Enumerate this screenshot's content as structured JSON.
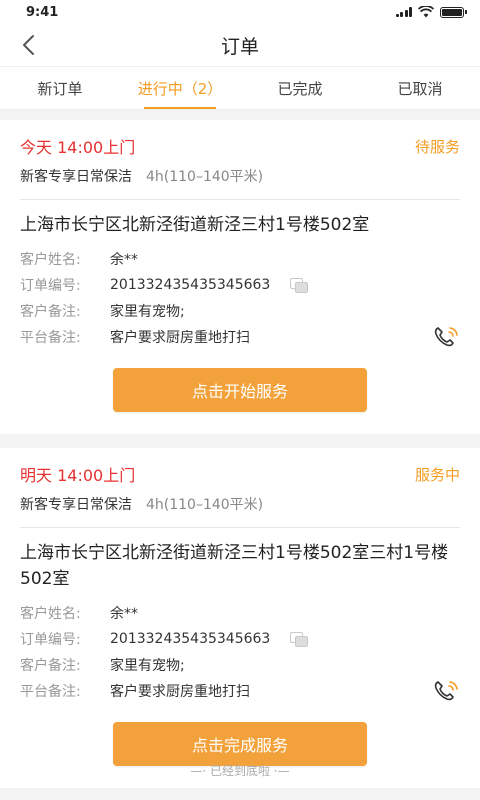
{
  "status_bar": {
    "time": "9:41"
  },
  "nav": {
    "title": "订单"
  },
  "tabs": [
    {
      "label": "新订单"
    },
    {
      "label": "进行中（2）"
    },
    {
      "label": "已完成"
    },
    {
      "label": "已取消"
    }
  ],
  "orders": [
    {
      "time": "今天 14:00上门",
      "status": "待服务",
      "service": "新客专享日常保洁",
      "duration": "4h(110–140平米)",
      "address": "上海市长宁区北新泾街道新泾三村1号楼502室",
      "customer_label": "客户姓名:",
      "customer": "余**",
      "order_no_label": "订单编号:",
      "order_no": "201332435435345663",
      "customer_note_label": "客户备注:",
      "customer_note": "家里有宠物;",
      "platform_note_label": "平台备注:",
      "platform_note": "客户要求厨房重地打扫",
      "button": "点击开始服务"
    },
    {
      "time": "明天 14:00上门",
      "status": "服务中",
      "service": "新客专享日常保洁",
      "duration": "4h(110–140平米)",
      "address": "上海市长宁区北新泾街道新泾三村1号楼502室三村1号楼502室",
      "customer_label": "客户姓名:",
      "customer": "余**",
      "order_no_label": "订单编号:",
      "order_no": "201332435435345663",
      "customer_note_label": "客户备注:",
      "customer_note": "家里有宠物;",
      "platform_note_label": "平台备注:",
      "platform_note": "客户要求厨房重地打扫",
      "button": "点击完成服务"
    }
  ],
  "footer": {
    "text": "—· 已经到底啦 ·—"
  },
  "colors": {
    "accent": "#f39c22",
    "time_red": "#e83030",
    "button": "#f3a23b"
  }
}
